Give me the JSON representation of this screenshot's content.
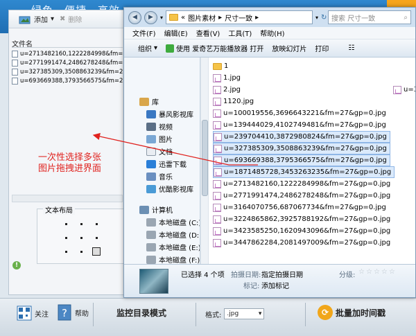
{
  "app": {
    "slogan": "绿色、便捷、高效",
    "left_panel": {
      "add_label": "添加",
      "delete_label": "删除",
      "file_header": "文件名",
      "files": [
        "u=2713482160,1222284998&fm=...",
        "u=2771991474,2486278248&fm=...",
        "u=327385309,3508863239&fm=2...",
        "u=693669388,3793566575&fm=2..."
      ],
      "layout_title": "文本布局"
    },
    "annotation": [
      "一次性选择多张",
      "图片拖拽进界面"
    ],
    "bottom": {
      "follow_label": "关注",
      "help_label": "帮助",
      "monitor_label": "监控目录模式",
      "format_label": "格式:",
      "format_value": ".jpg",
      "batch_label": "批量加时间戳"
    }
  },
  "explorer": {
    "address": [
      "«",
      "图片素材",
      "尺寸一致"
    ],
    "search_placeholder": "搜索 尺寸一致",
    "menu": [
      "文件(F)",
      "编辑(E)",
      "查看(V)",
      "工具(T)",
      "帮助(H)"
    ],
    "commands": {
      "organize": "组织",
      "open_with": "使用 爱奇艺万能播放器 打开",
      "slideshow": "放映幻灯片",
      "print": "打印"
    },
    "nav": {
      "library": "库",
      "items": [
        "暴风影视库",
        "视频",
        "图片",
        "文档",
        "迅雷下载",
        "音乐",
        "优酷影视库"
      ],
      "computer": "计算机",
      "drives": [
        "本地磁盘 (C:)",
        "本地磁盘 (D:)",
        "本地磁盘 (E:)",
        "本地磁盘 (F:)"
      ]
    },
    "files": [
      {
        "name": "1",
        "kind": "folder",
        "selected": false
      },
      {
        "name": "1.jpg",
        "kind": "image",
        "selected": false
      },
      {
        "name": "2.jpg",
        "kind": "image",
        "selected": false
      },
      {
        "name": "1120.jpg",
        "kind": "image",
        "selected": false
      },
      {
        "name": "u=100019556,3696643221&fm=27&gp=0.jpg",
        "kind": "image",
        "selected": false
      },
      {
        "name": "u=139444029,4102749481&fm=27&gp=0.jpg",
        "kind": "image",
        "selected": false
      },
      {
        "name": "u=239704410,3872980824&fm=27&gp=0.jpg",
        "kind": "image",
        "selected": true
      },
      {
        "name": "u=327385309,3508863239&fm=27&gp=0.jpg",
        "kind": "image",
        "selected": true
      },
      {
        "name": "u=693669388,3795366575&fm=27&gp=0.jpg",
        "kind": "image",
        "selected": true
      },
      {
        "name": "u=1871485728,3453263235&fm=27&gp=0.jpg",
        "kind": "image",
        "selected": true
      },
      {
        "name": "u=2713482160,1222284998&fm=27&gp=0.jpg",
        "kind": "image",
        "selected": false
      },
      {
        "name": "u=2771991474,2486278248&fm=27&gp=0.jpg",
        "kind": "image",
        "selected": false
      },
      {
        "name": "u=3164070756,687067734&fm=27&gp=0.jpg",
        "kind": "image",
        "selected": false
      },
      {
        "name": "u=3224865862,3925788192&fm=27&gp=0.jpg",
        "kind": "image",
        "selected": false
      },
      {
        "name": "u=3423585250,1620943096&fm=27&gp=0.jpg",
        "kind": "image",
        "selected": false
      },
      {
        "name": "u=3447862284,2081497009&fm=27&gp=0.jpg",
        "kind": "image",
        "selected": false
      }
    ],
    "right_partial": "u=3",
    "details": {
      "selected_text": "已选择 4 个项",
      "date_label": "拍摄日期:",
      "date_value": "指定拍摄日期",
      "tag_label": "标记:",
      "tag_value": "添加标记",
      "rating_label": "分级:"
    }
  }
}
